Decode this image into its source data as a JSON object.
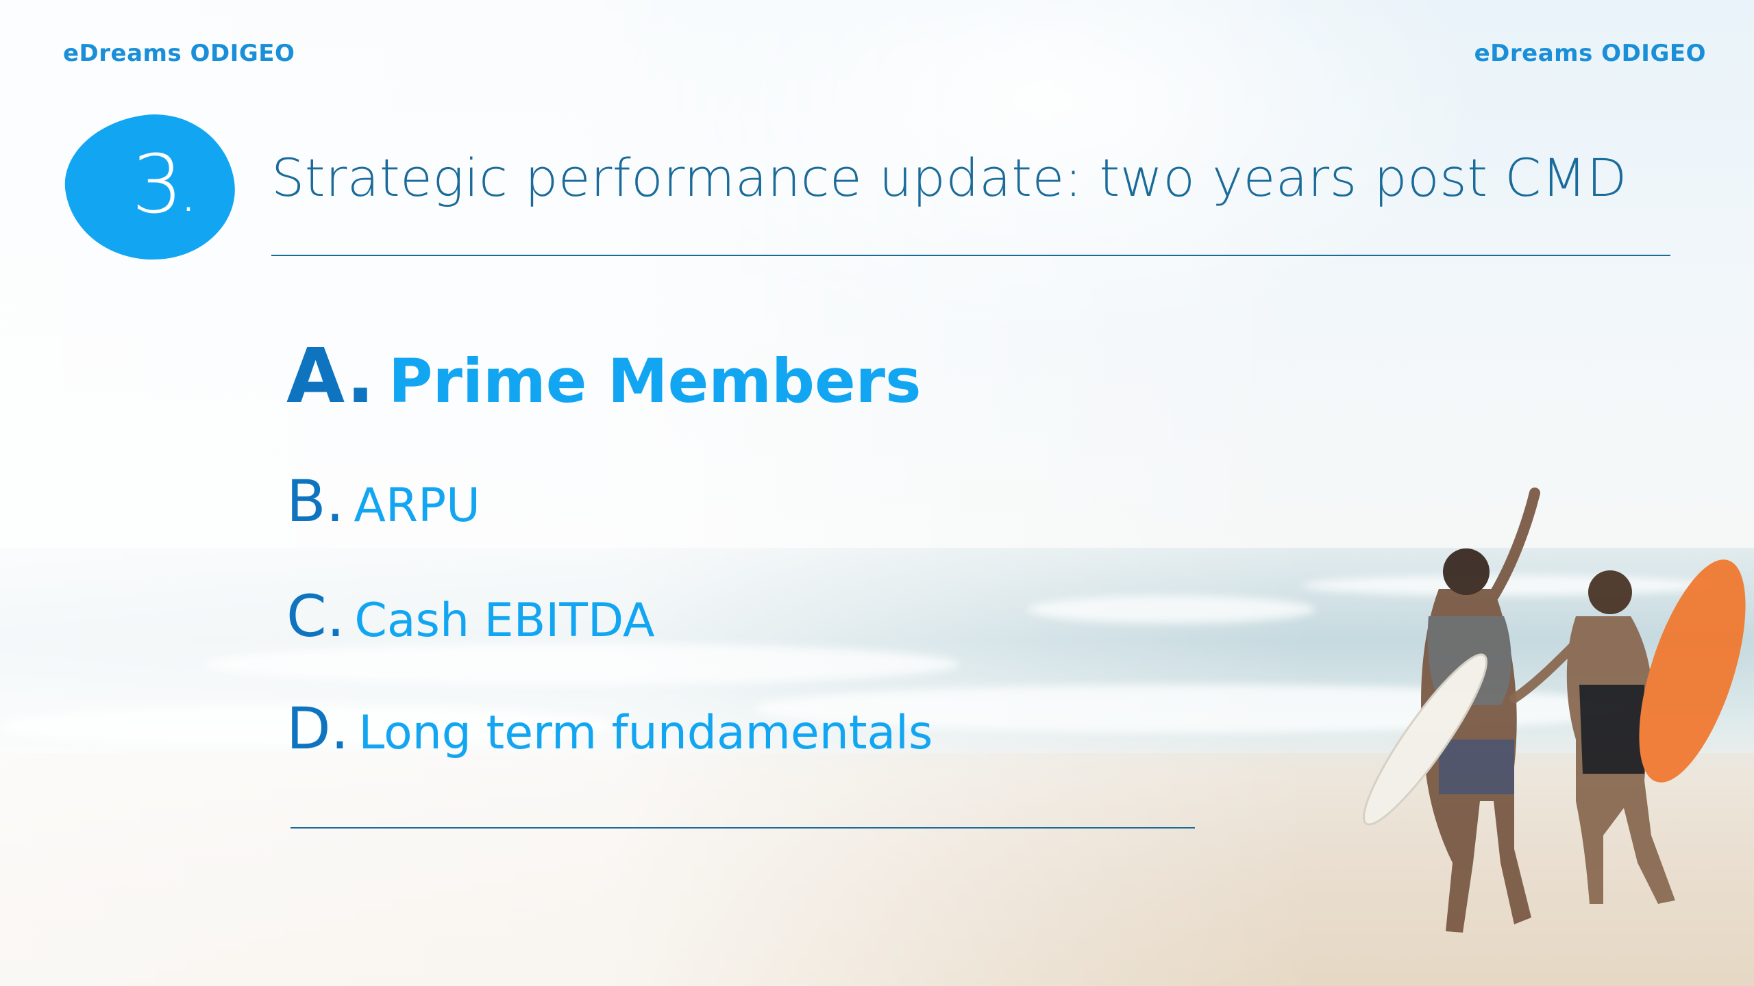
{
  "brand": {
    "left_label": "eDreams ODIGEO",
    "right_label": "eDreams ODIGEO"
  },
  "section": {
    "number": "3",
    "number_suffix": ".",
    "title": "Strategic performance update: two years post CMD"
  },
  "agenda": {
    "items": [
      {
        "letter": "A.",
        "label": "Prime Members",
        "active": true
      },
      {
        "letter": "B.",
        "label": "ARPU",
        "active": false
      },
      {
        "letter": "C.",
        "label": "Cash EBITDA",
        "active": false
      },
      {
        "letter": "D.",
        "label": "Long term fundamentals",
        "active": false
      }
    ]
  },
  "colors": {
    "brand_blue": "#1a8fd8",
    "accent_blue": "#12a6f2",
    "letter_blue": "#0e74c0",
    "rule_blue": "#1a6b9a"
  },
  "icons": {
    "section_badge": "blob-shape",
    "background": "beach-surfers-photo"
  }
}
